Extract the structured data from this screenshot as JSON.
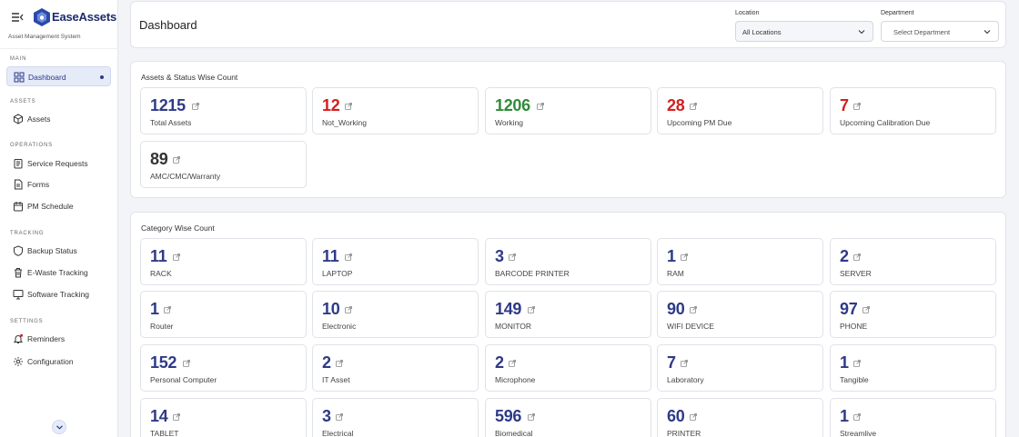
{
  "brand": {
    "name": "EaseAssets",
    "subtitle": "Asset Management System"
  },
  "sidebar": {
    "sections": [
      {
        "title": "MAIN"
      },
      {
        "title": "ASSETS"
      },
      {
        "title": "OPERATIONS"
      },
      {
        "title": "TRACKING"
      },
      {
        "title": "SETTINGS"
      }
    ],
    "items": [
      {
        "label": "Dashboard",
        "icon": "grid-icon",
        "active": true
      },
      {
        "label": "Assets",
        "icon": "cube-icon"
      },
      {
        "label": "Service Requests",
        "icon": "clipboard-icon"
      },
      {
        "label": "Forms",
        "icon": "document-icon"
      },
      {
        "label": "PM Schedule",
        "icon": "calendar-icon"
      },
      {
        "label": "Backup Status",
        "icon": "shield-icon"
      },
      {
        "label": "E-Waste Tracking",
        "icon": "trash-icon"
      },
      {
        "label": "Software Tracking",
        "icon": "monitor-icon"
      },
      {
        "label": "Reminders",
        "icon": "bell-icon"
      },
      {
        "label": "Configuration",
        "icon": "gear-icon"
      }
    ]
  },
  "header": {
    "title": "Dashboard",
    "location": {
      "label": "Location",
      "value": "All Locations"
    },
    "department": {
      "label": "Department",
      "placeholder": "Select Department"
    }
  },
  "status": {
    "title": "Assets & Status Wise Count",
    "cards": [
      {
        "value": "1215",
        "label": "Total Assets",
        "color": "#2e3a87"
      },
      {
        "value": "12",
        "label": "Not_Working",
        "color": "#d32020"
      },
      {
        "value": "1206",
        "label": "Working",
        "color": "#2e8b3a"
      },
      {
        "value": "28",
        "label": "Upcoming PM Due",
        "color": "#d32020"
      },
      {
        "value": "7",
        "label": "Upcoming Calibration Due",
        "color": "#d32020"
      },
      {
        "value": "89",
        "label": "AMC/CMC/Warranty",
        "color": "#333333"
      }
    ]
  },
  "category": {
    "title": "Category Wise Count",
    "cards": [
      {
        "value": "11",
        "label": "RACK"
      },
      {
        "value": "11",
        "label": "LAPTOP"
      },
      {
        "value": "3",
        "label": "BARCODE PRINTER"
      },
      {
        "value": "1",
        "label": "RAM"
      },
      {
        "value": "2",
        "label": "SERVER"
      },
      {
        "value": "1",
        "label": "Router"
      },
      {
        "value": "10",
        "label": "Electronic"
      },
      {
        "value": "149",
        "label": "MONITOR"
      },
      {
        "value": "90",
        "label": "WIFI DEVICE"
      },
      {
        "value": "97",
        "label": "PHONE"
      },
      {
        "value": "152",
        "label": "Personal Computer"
      },
      {
        "value": "2",
        "label": "IT Asset"
      },
      {
        "value": "2",
        "label": "Microphone"
      },
      {
        "value": "7",
        "label": "Laboratory"
      },
      {
        "value": "1",
        "label": "Tangible"
      },
      {
        "value": "14",
        "label": "TABLET"
      },
      {
        "value": "3",
        "label": "Electrical"
      },
      {
        "value": "596",
        "label": "Biomedical"
      },
      {
        "value": "60",
        "label": "PRINTER"
      },
      {
        "value": "1",
        "label": "Streamlive"
      }
    ]
  }
}
